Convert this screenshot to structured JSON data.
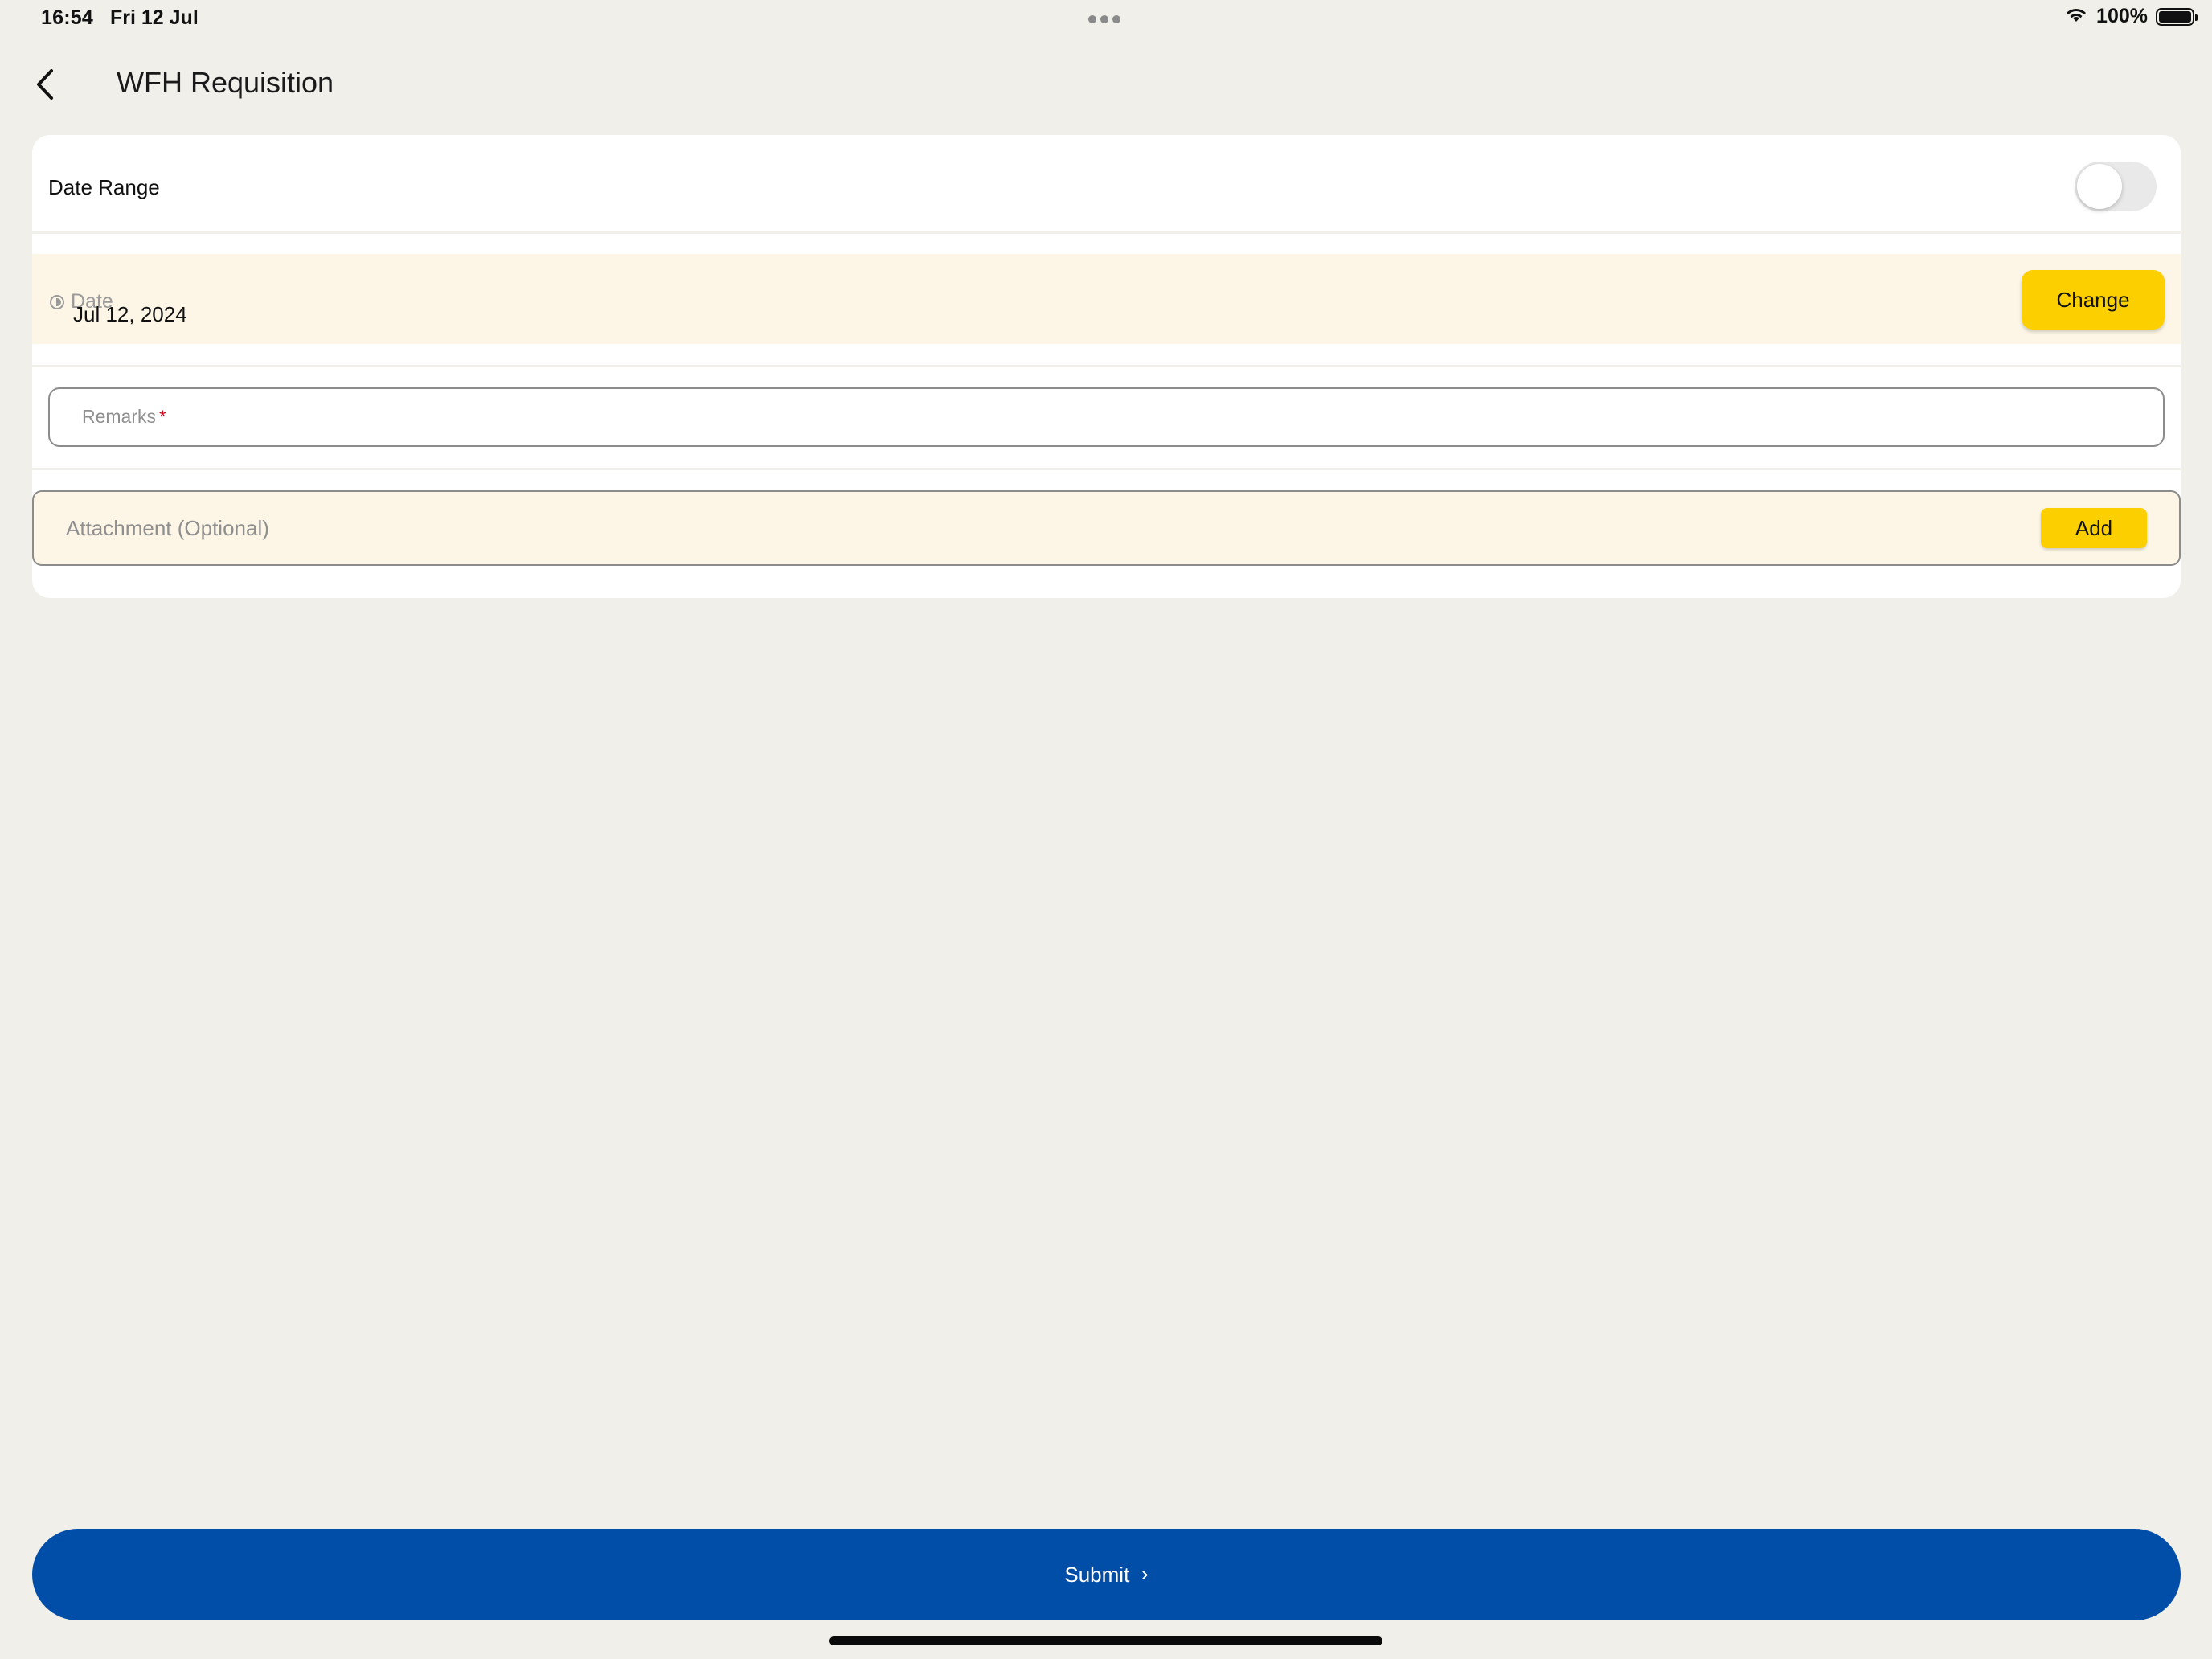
{
  "status_bar": {
    "time": "16:54",
    "date": "Fri 12 Jul",
    "battery": "100%"
  },
  "header": {
    "title": "WFH Requisition"
  },
  "form": {
    "date_range": {
      "label": "Date Range",
      "enabled": false
    },
    "date": {
      "caption": "Date",
      "value": "Jul 12, 2024",
      "change_label": "Change"
    },
    "remarks": {
      "label": "Remarks",
      "required_mark": "*",
      "value": ""
    },
    "attachment": {
      "label": "Attachment (Optional)",
      "add_label": "Add"
    }
  },
  "footer": {
    "submit_label": "Submit"
  },
  "colors": {
    "background": "#f0efea",
    "accent_yellow": "#fcd000",
    "primary_blue": "#004ea8",
    "highlight_row": "#fdf6e6"
  },
  "icons": [
    "back-chevron-icon",
    "wifi-icon",
    "battery-icon",
    "clock-icon",
    "chevron-right-icon"
  ]
}
